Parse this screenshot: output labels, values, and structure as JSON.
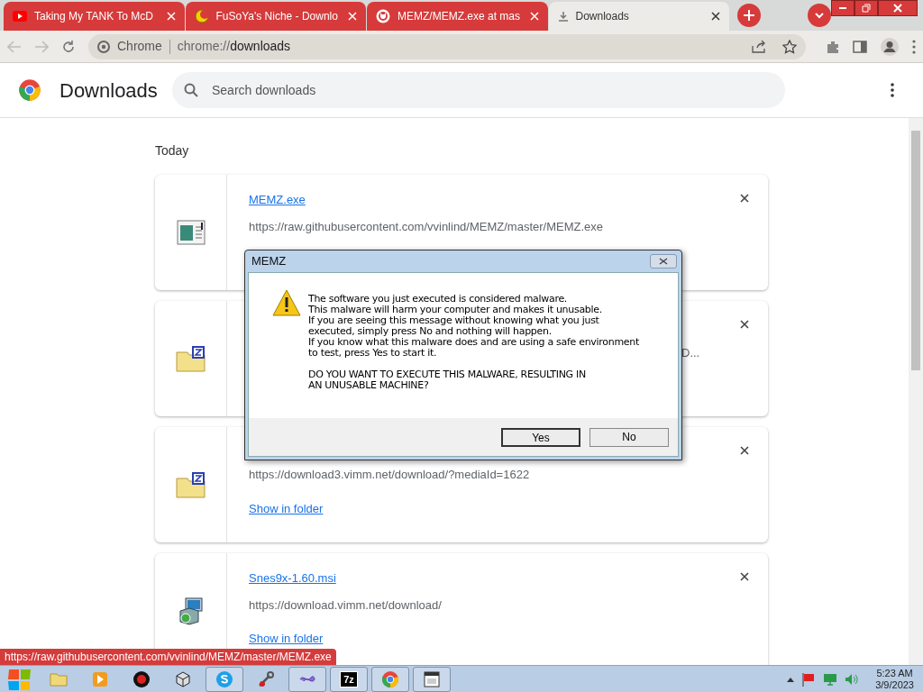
{
  "tabs": [
    {
      "title": "Taking My TANK To McD",
      "kind": "youtube",
      "selected": false
    },
    {
      "title": "FuSoYa's Niche - Downlo",
      "kind": "moon",
      "selected": false
    },
    {
      "title": "MEMZ/MEMZ.exe at mas",
      "kind": "github",
      "selected": false
    },
    {
      "title": "Downloads",
      "kind": "download",
      "selected": true
    }
  ],
  "omnibox": {
    "chip": "Chrome",
    "url_scheme": "chrome://",
    "url_host": "downloads"
  },
  "header": {
    "title": "Downloads",
    "search_placeholder": "Search downloads"
  },
  "section": "Today",
  "downloads": [
    {
      "kind": "exe",
      "name": "MEMZ.exe",
      "url": "https://raw.githubusercontent.com/vvinlind/MEMZ/master/MEMZ.exe"
    },
    {
      "kind": "zip",
      "url_tail": "D..."
    },
    {
      "kind": "zip",
      "url": "https://download3.vimm.net/download/?mediaId=1622",
      "action": "Show in folder"
    },
    {
      "kind": "msi",
      "name": "Snes9x-1.60.msi",
      "url": "https://download.vimm.net/download/",
      "action": "Show in folder"
    }
  ],
  "dialog": {
    "title": "MEMZ",
    "lines": [
      "The software you just executed is considered malware.",
      "This malware will harm your computer and makes it unusable.",
      "If you are seeing this message without knowing what you just",
      "executed, simply press No and nothing will happen.",
      "If you know what this malware does and are using a safe environment",
      "to test, press Yes to start it."
    ],
    "question": [
      "DO YOU WANT TO EXECUTE THIS MALWARE, RESULTING IN",
      "AN UNUSABLE MACHINE?"
    ],
    "buttons": [
      {
        "label": "Yes",
        "selected": true
      },
      {
        "label": "No",
        "selected": false
      }
    ]
  },
  "status_bubble": "https://raw.githubusercontent.com/vvinlind/MEMZ/master/MEMZ.exe",
  "taskbar": {
    "items": [
      {
        "kind": "folder",
        "active": false
      },
      {
        "kind": "media",
        "active": false
      },
      {
        "kind": "record",
        "active": false
      },
      {
        "kind": "cube",
        "active": false
      },
      {
        "kind": "skype",
        "active": true
      },
      {
        "kind": "tool",
        "active": false
      },
      {
        "kind": "swirl",
        "active": true
      },
      {
        "kind": "sevenzip",
        "text": "7z",
        "active": true
      },
      {
        "kind": "chrome",
        "active": true
      },
      {
        "kind": "window",
        "active": true
      }
    ],
    "time": "5:23 AM",
    "date": "3/9/2023"
  }
}
